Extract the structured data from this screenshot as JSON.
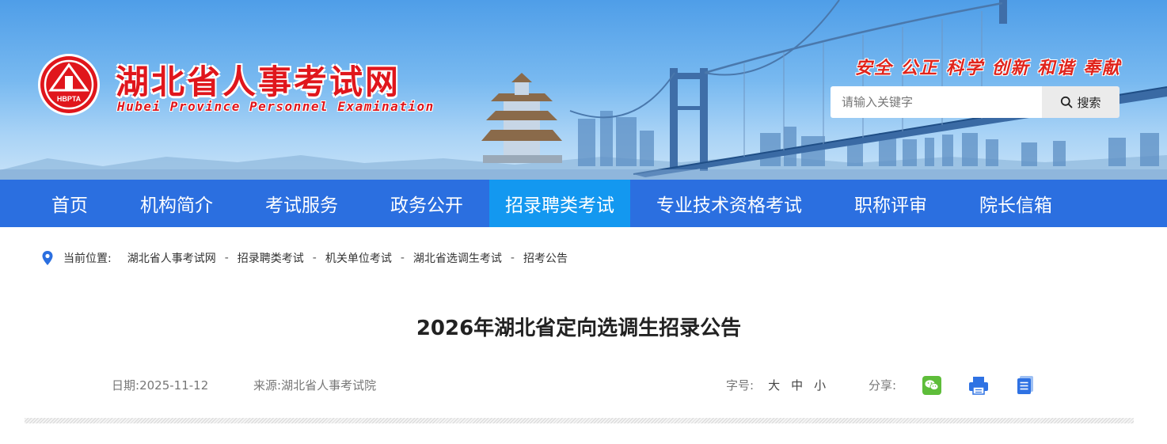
{
  "header": {
    "logo_text": "HBPTA",
    "site_title": "湖北省人事考试网",
    "site_subtitle": "Hubei Province Personnel Examination",
    "slogan": "安全 公正 科学 创新 和谐 奉献",
    "search": {
      "placeholder": "请输入关键字",
      "button_label": "搜索"
    }
  },
  "nav": {
    "items": [
      {
        "label": "首页"
      },
      {
        "label": "机构简介"
      },
      {
        "label": "考试服务"
      },
      {
        "label": "政务公开"
      },
      {
        "label": "招录聘类考试"
      },
      {
        "label": "专业技术资格考试"
      },
      {
        "label": "职称评审"
      },
      {
        "label": "院长信箱"
      }
    ],
    "active_index": 4
  },
  "breadcrumb": {
    "lead": "当前位置:",
    "items": [
      "湖北省人事考试网",
      "招录聘类考试",
      "机关单位考试",
      "湖北省选调生考试",
      "招考公告"
    ],
    "separator": "-"
  },
  "article": {
    "title": "2026年湖北省定向选调生招录公告",
    "date_label": "日期:",
    "date": "2025-11-12",
    "source_label": "来源:",
    "source": "湖北省人事考试院",
    "fontsize_label": "字号:",
    "fontsize_options": [
      "大",
      "中",
      "小"
    ],
    "share_label": "分享:",
    "share_icons": [
      "wechat-icon",
      "print-icon",
      "document-icon"
    ]
  },
  "colors": {
    "nav_bg": "#2b6fe0",
    "nav_active": "#1398f0",
    "brand_red": "#e0161c",
    "wechat_green": "#5ebd3a",
    "icon_blue": "#2f72e3"
  }
}
